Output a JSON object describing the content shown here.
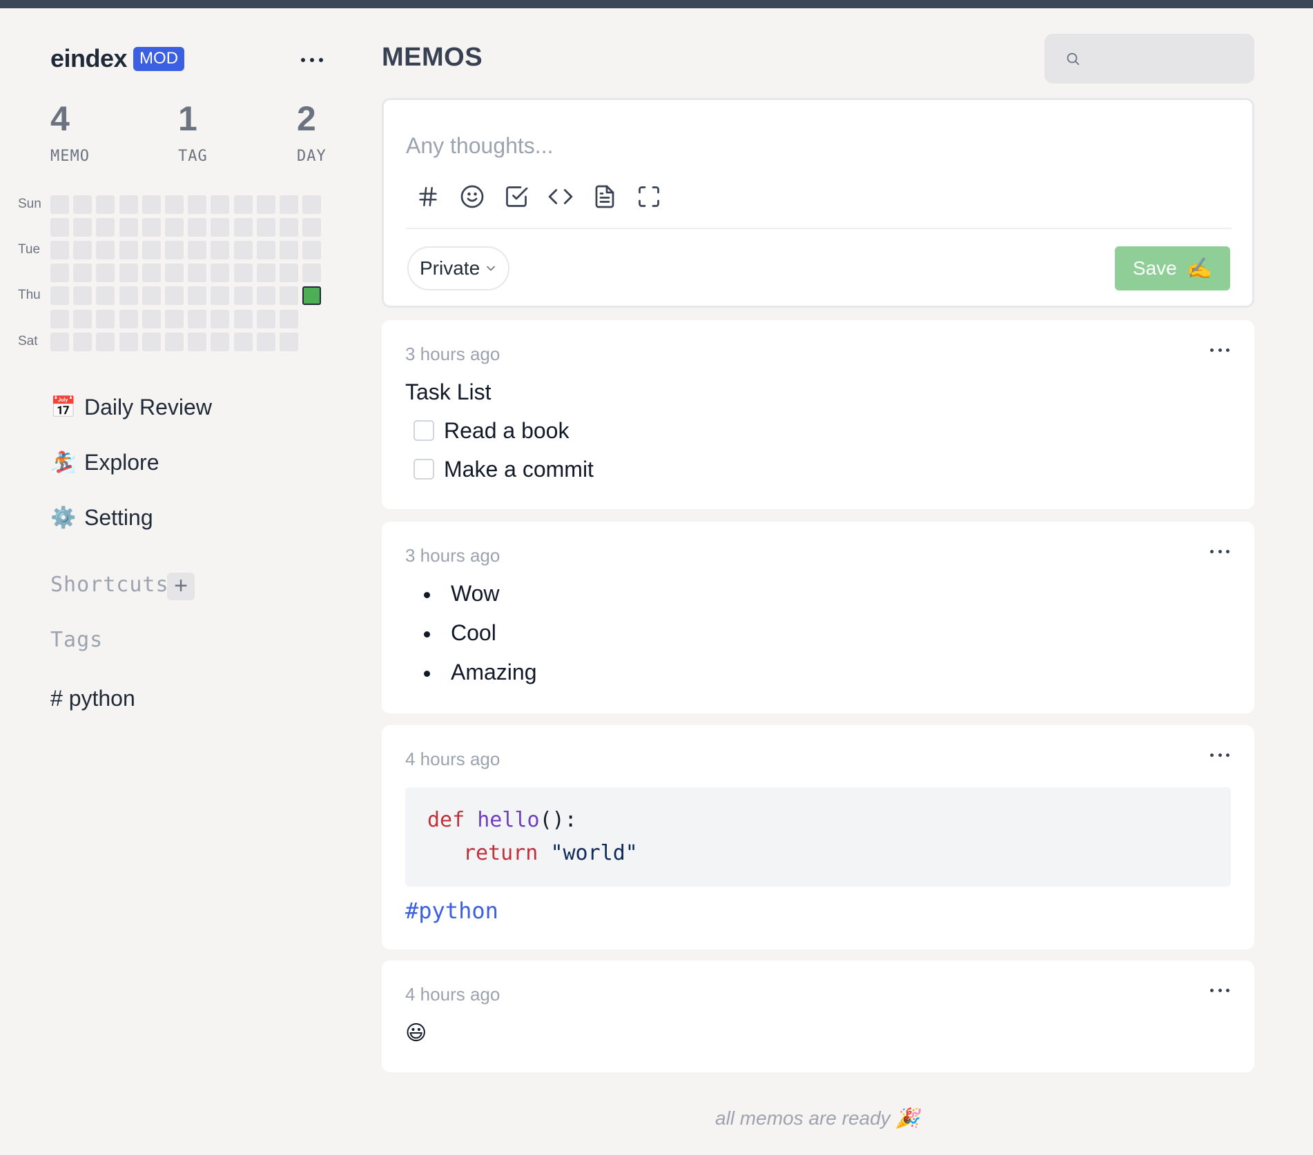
{
  "colors": {
    "accent": "#3b5fe0",
    "save_button": "#8fcf97",
    "heatmap_active": "#4caf55",
    "heatmap_empty": "#e5e5e8",
    "background": "#f5f4f2"
  },
  "sidebar": {
    "username": "eindex",
    "role_badge": "MOD",
    "more_icon": "more-horizontal-icon",
    "stats": [
      {
        "value": "4",
        "label": "MEMO"
      },
      {
        "value": "1",
        "label": "TAG"
      },
      {
        "value": "2",
        "label": "DAY"
      }
    ],
    "heatmap": {
      "day_labels": [
        "Sun",
        "",
        "Tue",
        "",
        "Thu",
        "",
        "Sat"
      ],
      "weeks": 12,
      "active_cell": {
        "weekday": "Thu",
        "week_index": 11,
        "level": 1
      }
    },
    "nav": [
      {
        "emoji": "📅",
        "label": "Daily Review",
        "icon": "calendar-icon"
      },
      {
        "emoji": "🏂",
        "label": "Explore",
        "icon": "snowboarder-icon"
      },
      {
        "emoji": "⚙️",
        "label": "Setting",
        "icon": "gear-icon"
      }
    ],
    "shortcuts_title": "Shortcuts",
    "add_shortcut_symbol": "+",
    "tags_title": "Tags",
    "tags": [
      "# python"
    ]
  },
  "header": {
    "title": "MEMOS",
    "search_placeholder": ""
  },
  "editor": {
    "placeholder": "Any thoughts...",
    "tools": [
      "hashtag-icon",
      "emoji-icon",
      "checkbox-icon",
      "code-icon",
      "file-icon",
      "fullscreen-icon"
    ],
    "visibility": "Private",
    "save_label": "Save",
    "save_emoji": "✍️"
  },
  "memos": [
    {
      "time": "3 hours ago",
      "title": "Task List",
      "tasks": [
        "Read a book",
        "Make a commit"
      ]
    },
    {
      "time": "3 hours ago",
      "bullets": [
        "Wow",
        "Cool",
        "Amazing"
      ]
    },
    {
      "time": "4 hours ago",
      "code": {
        "line1": {
          "kw": "def",
          "fn": "hello",
          "punc": "():"
        },
        "line2": {
          "kw": "return",
          "str": "\"world\""
        }
      },
      "tag": "#python"
    },
    {
      "time": "4 hours ago",
      "emoji": "😃"
    }
  ],
  "footer": "all memos are ready 🎉"
}
